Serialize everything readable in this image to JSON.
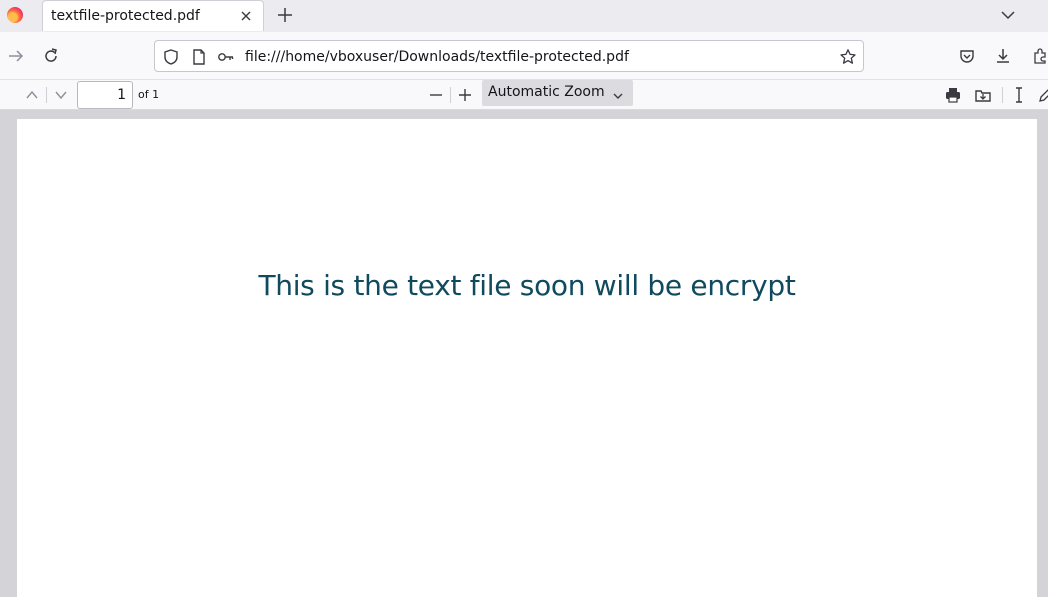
{
  "browser": {
    "tab_title": "textfile-protected.pdf",
    "url": "file:///home/vboxuser/Downloads/textfile-protected.pdf"
  },
  "pdf_toolbar": {
    "page_number": "1",
    "page_count_label": "of 1",
    "zoom_label": "Automatic Zoom"
  },
  "document": {
    "body_text": "This is the text file soon will be encrypt"
  },
  "colors": {
    "document_text": "#0f4a5e",
    "viewer_background": "#d4d4d8"
  }
}
